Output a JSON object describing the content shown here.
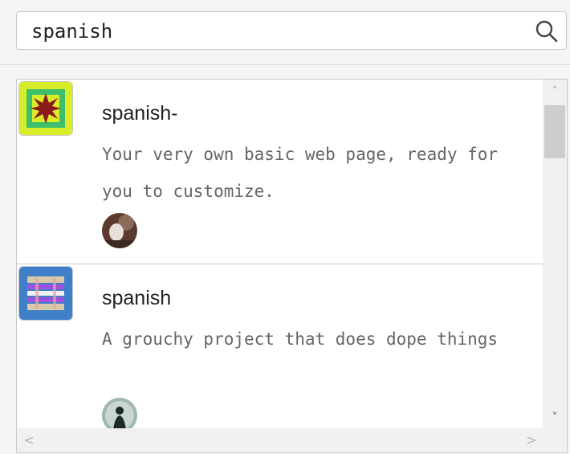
{
  "search": {
    "value": "spanish"
  },
  "results": [
    {
      "title": "spanish-",
      "description": "Your very own basic web page, ready for you to customize.",
      "thumbnail_icon": "sun-badge-icon",
      "thumbnail_colors": {
        "outer": "#d9ec2a",
        "inner": "#3fbf6a",
        "center": "#8b1a1a"
      },
      "avatar_icon": "user-avatar"
    },
    {
      "title": "spanish",
      "description": "A grouchy project that does dope things",
      "thumbnail_icon": "stripes-badge-icon",
      "thumbnail_colors": {
        "outer": "#3f7fc7",
        "inner": "#c9a3e8",
        "center": "#a050e0"
      },
      "avatar_icon": "user-avatar"
    }
  ],
  "scrollbars": {
    "up": "˄",
    "down": "˅",
    "left": "<",
    "right": ">"
  }
}
